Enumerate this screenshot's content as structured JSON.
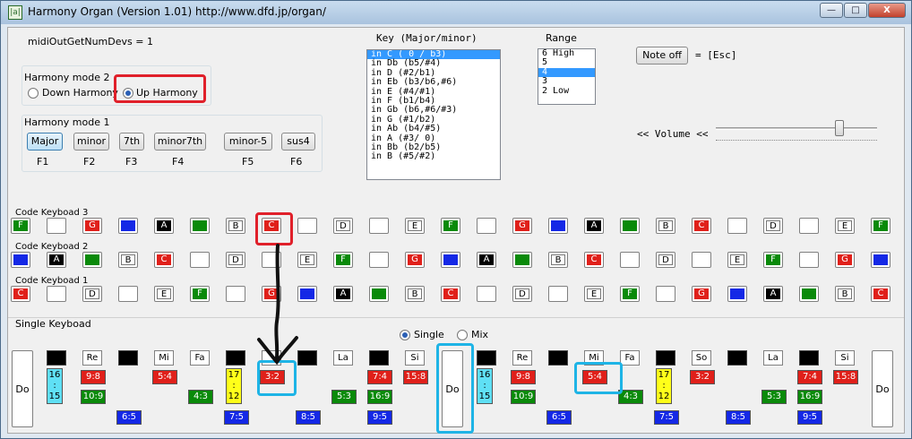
{
  "window": {
    "title": "Harmony Organ (Version 1.01)     http://www.dfd.jp/organ/",
    "icon_label": "|a|",
    "minimize": "—",
    "maximize": "□",
    "close": "X"
  },
  "midi_status": "midiOutGetNumDevs = 1",
  "harmony_mode2": {
    "label": "Harmony mode 2",
    "options": [
      "Down Harmony",
      "Up Harmony"
    ],
    "selected": "Up Harmony"
  },
  "harmony_mode1": {
    "label": "Harmony mode 1",
    "buttons": [
      {
        "label": "Major",
        "fkey": "F1",
        "selected": true
      },
      {
        "label": "minor",
        "fkey": "F2"
      },
      {
        "label": "7th",
        "fkey": "F3"
      },
      {
        "label": "minor7th",
        "fkey": "F4"
      },
      {
        "label": "minor-5",
        "fkey": "F5"
      },
      {
        "label": "sus4",
        "fkey": "F6"
      }
    ]
  },
  "key_list": {
    "header": "Key  (Major/minor)",
    "items": [
      "in C  ( 0 / b3)",
      "in Db (b5/#4)",
      "in D  (#2/b1)",
      "in Eb (b3/b6,#6)",
      "in E  (#4/#1)",
      "in F  (b1/b4)",
      "in Gb (b6,#6/#3)",
      "in G  (#1/b2)",
      "in Ab (b4/#5)",
      "in A  (#3/ 0)",
      "in Bb (b2/b5)",
      "in B  (#5/#2)"
    ],
    "selected_index": 0
  },
  "range_list": {
    "header": "Range",
    "items": [
      "6  High",
      "5",
      "4",
      "3",
      "2  Low"
    ],
    "selected_index": 2
  },
  "note_off": {
    "button": "Note off",
    "hint": "= [Esc]"
  },
  "volume": {
    "label": "<< Volume <<",
    "level": 0.78
  },
  "colors": {
    "F": "#0a8a0a",
    "G": "#e0201a",
    "A": "#000000",
    "B": "#ffffff",
    "C": "#e0201a",
    "D": "#ffffff",
    "E": "#ffffff",
    "blue": "#1428e6",
    "green": "#0a8a0a",
    "empty": "#ffffff",
    "highlight_red": "#e0202a",
    "highlight_cyan": "#1eb4e6"
  },
  "code_keyboards": [
    {
      "label": "Code Keyboad 3",
      "keys": [
        "F",
        "",
        "G",
        "blue",
        "A",
        "green",
        "B",
        "C",
        "",
        "D",
        "",
        "E",
        "F",
        "",
        "G",
        "blue",
        "A",
        "green",
        "B",
        "C",
        "",
        "D",
        "",
        "E",
        "F"
      ]
    },
    {
      "label": "Code Keyboad 2",
      "keys": [
        "blue",
        "A",
        "green",
        "B",
        "C",
        "",
        "D",
        "",
        "E",
        "F",
        "",
        "G",
        "blue",
        "A",
        "green",
        "B",
        "C",
        "",
        "D",
        "",
        "E",
        "F",
        "",
        "G",
        "blue"
      ]
    },
    {
      "label": "Code Keyboad 1",
      "keys": [
        "C",
        "",
        "D",
        "",
        "E",
        "F",
        "",
        "G",
        "blue",
        "A",
        "green",
        "B",
        "C",
        "",
        "D",
        "",
        "E",
        "F",
        "",
        "G",
        "blue",
        "A",
        "green",
        "B",
        "C"
      ]
    }
  ],
  "single_keyboard": {
    "label": "Single Keyboad",
    "mode_options": [
      "Single",
      "Mix"
    ],
    "mode_selected": "Single",
    "white_keys": [
      "Do",
      "Do",
      "Do"
    ],
    "keys_row": [
      "black",
      "Re",
      "black",
      "Mi",
      "Fa",
      "black",
      "",
      "black",
      "La",
      "black",
      "Si",
      "",
      "black",
      "Re",
      "black",
      "Mi",
      "Fa",
      "black",
      "So",
      "black",
      "La",
      "black",
      "Si"
    ],
    "ratios_red": [
      {
        "text": "9:8",
        "col": 1
      },
      {
        "text": "5:4",
        "col": 3
      },
      {
        "text": "3:2",
        "col": 6
      },
      {
        "text": "7:4",
        "col": 9
      },
      {
        "text": "15:8",
        "col": 10
      },
      {
        "text": "9:8",
        "col": 13
      },
      {
        "text": "5:4",
        "col": 15
      },
      {
        "text": "3:2",
        "col": 18
      },
      {
        "text": "7:4",
        "col": 21
      },
      {
        "text": "15:8",
        "col": 22
      }
    ],
    "ratios_green": [
      {
        "text": "10:9",
        "col": 1
      },
      {
        "text": "4:3",
        "col": 4
      },
      {
        "text": "5:3",
        "col": 8
      },
      {
        "text": "16:9",
        "col": 9
      },
      {
        "text": "10:9",
        "col": 13
      },
      {
        "text": "4:3",
        "col": 16
      },
      {
        "text": "5:3",
        "col": 20
      },
      {
        "text": "16:9",
        "col": 21
      }
    ],
    "ratios_blue": [
      {
        "text": "6:5",
        "col": 2
      },
      {
        "text": "7:5",
        "col": 5
      },
      {
        "text": "8:5",
        "col": 7
      },
      {
        "text": "9:5",
        "col": 9
      },
      {
        "text": "6:5",
        "col": 14
      },
      {
        "text": "7:5",
        "col": 17
      },
      {
        "text": "8:5",
        "col": 19
      },
      {
        "text": "9:5",
        "col": 21
      }
    ],
    "ratios_cyan": [
      {
        "lines": [
          "16",
          ":",
          "15"
        ],
        "col": 0
      },
      {
        "lines": [
          "16",
          ":",
          "15"
        ],
        "col": 12
      }
    ],
    "ratios_yellow": [
      {
        "lines": [
          "17",
          ":",
          "12"
        ],
        "col": 5
      },
      {
        "lines": [
          "17",
          ":",
          "12"
        ],
        "col": 17
      }
    ]
  }
}
